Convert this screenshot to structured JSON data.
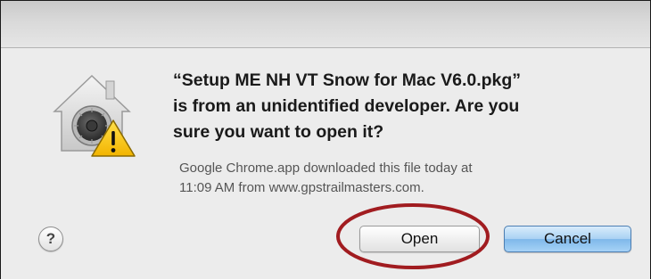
{
  "dialog": {
    "message": "“Setup ME NH VT Snow for Mac V6.0.pkg”\nis from an unidentified developer. Are you\nsure you want to open it?",
    "info": "Google Chrome.app downloaded this file today at\n11:09 AM from www.gpstrailmasters.com.",
    "icon": "gatekeeper-security-icon"
  },
  "buttons": {
    "help_label": "?",
    "open_label": "Open",
    "cancel_label": "Cancel"
  },
  "colors": {
    "annotation_ring": "#a11c20",
    "warning_yellow": "#f7c51a",
    "default_button_blue": "#8cc2ee"
  }
}
